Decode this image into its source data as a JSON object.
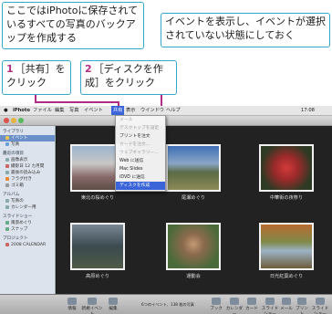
{
  "callouts": {
    "intro": "ここではiPhotoに保存されているすべての写真のバックアップを作成する",
    "note": "イベントを表示し、イベントが選択されていない状態にしておく",
    "step1_num": "1",
    "step1_text": "［共有］をクリック",
    "step2_num": "2",
    "step2_text": "［ディスクを作成］をクリック"
  },
  "menubar": {
    "apple": "",
    "items": [
      "iPhoto",
      "ファイル",
      "編集",
      "写真",
      "イベント",
      "共有",
      "表示",
      "ウインドウ",
      "ヘルプ"
    ],
    "clock": "17:08"
  },
  "share_menu": {
    "items": [
      {
        "label": "メール",
        "disabled": true
      },
      {
        "label": "デスクトップを設定",
        "disabled": true
      },
      {
        "label": "プリントを注文",
        "disabled": false
      },
      {
        "label": "カードを注文...",
        "disabled": true
      },
      {
        "label": "ウェブギャラリー...",
        "disabled": true
      },
      {
        "label": "Web に送信",
        "disabled": false
      },
      {
        "label": "Mac Slides",
        "disabled": false
      },
      {
        "label": "iDVD に送信",
        "disabled": false
      },
      {
        "label": "ディスクを作成",
        "disabled": false
      }
    ]
  },
  "sidebar": {
    "sections": [
      {
        "title": "ライブラリ",
        "items": [
          "イベント",
          "写真"
        ]
      },
      {
        "title": "最近の項目",
        "items": [
          "画像表示",
          "撮影日 12 カ月間",
          "最後の読み込み",
          "フラグ付き",
          "ゴミ箱"
        ]
      },
      {
        "title": "アルバム",
        "items": [
          "写真の",
          "カレンダー用"
        ]
      },
      {
        "title": "スライドショー",
        "items": [
          "風景めぐり",
          "スナップ"
        ]
      },
      {
        "title": "プロジェクト",
        "items": [
          "2008 CALENDAR"
        ]
      }
    ]
  },
  "photos": [
    {
      "caption": "東北の桜めぐり"
    },
    {
      "caption": "尾瀬めぐり"
    },
    {
      "caption": "中華街の夜祭り"
    },
    {
      "caption": "高原めぐり"
    },
    {
      "caption": "運動会"
    },
    {
      "caption": "日光紅葉めぐり"
    }
  ],
  "bottombar": {
    "left_buttons": [
      "情報",
      "新規イベント",
      "編集"
    ],
    "event_count": "6つのイベント、138 枚の写真",
    "right_buttons": [
      "ブック",
      "カレンダー",
      "カード",
      "スライドショー",
      "メール",
      "プリント",
      "スライドショー"
    ]
  },
  "colors": {
    "accent": "#b02b86",
    "callout_border": "#38a7cf",
    "menu_highlight": "#3a64d8"
  }
}
